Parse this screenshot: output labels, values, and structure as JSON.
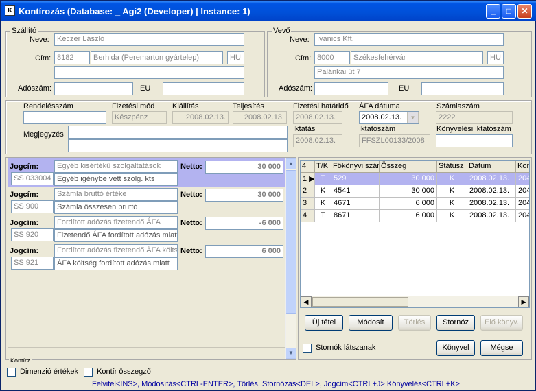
{
  "window": {
    "title": "Kontírozás    (Database: _ Agi2 (Developer) | Instance: 1)",
    "icon": "app-icon",
    "min": "_",
    "max": "□",
    "close": "✕"
  },
  "supplier": {
    "legend": "Szállító",
    "name_label": "Neve:",
    "name": "Keczer László",
    "address_label": "Cím:",
    "zip": "8182",
    "city": "Berhida (Peremarton gyártelep)",
    "country": "HU",
    "street": "",
    "tax_label": "Adószám:",
    "tax": "",
    "eu_label": "EU",
    "eu": ""
  },
  "buyer": {
    "legend": "Vevő",
    "name_label": "Neve:",
    "name": "Ivanics Kft.",
    "address_label": "Cím:",
    "zip": "8000",
    "city": "Székesfehérvár",
    "country": "HU",
    "street": "Palánkai út 7",
    "tax_label": "Adószám:",
    "tax": "",
    "eu_label": "EU",
    "eu": ""
  },
  "invoice": {
    "order_label": "Rendelésszám",
    "order": "",
    "pay_label": "Fizetési mód",
    "pay": "Készpénz",
    "issue_label": "Kiállítás",
    "issue": "2008.02.13.",
    "perf_label": "Teljesítés",
    "perf": "2008.02.13.",
    "due_label": "Fizetési határidő",
    "due": "2008.02.13.",
    "vat_label": "ÁFA dátuma",
    "vat": "2008.02.13.",
    "invno_label": "Számlaszám",
    "invno": "2222",
    "note_label": "Megjegyzés",
    "note": "",
    "filing_label": "Iktatás",
    "filing": "2008.02.13.",
    "filingno_label": "Iktatószám",
    "filingno": "FFSZL00133/2008",
    "acctfiling_label": "Könyvelési iktatószám",
    "acctfiling": ""
  },
  "postings": [
    {
      "jogcim_label": "Jogcím:",
      "code": "SS 033004",
      "line1": "Egyéb kisértékű szolgáltatások",
      "line2": "Egyéb igénybe vett szolg. kts",
      "netto_label": "Netto:",
      "amount": "30 000"
    },
    {
      "jogcim_label": "Jogcím:",
      "code": "SS 900",
      "line1": "Számla bruttó értéke",
      "line2": "Számla összesen bruttó",
      "netto_label": "Netto:",
      "amount": "30 000"
    },
    {
      "jogcim_label": "Jogcím:",
      "code": "SS 920",
      "line1": "Fordított adózás fizetendő ÁFA",
      "line2": "Fizetendő ÁFA fordított adózás miatt",
      "netto_label": "Netto:",
      "amount": "-6 000"
    },
    {
      "jogcim_label": "Jogcím:",
      "code": "SS 921",
      "line1": "Fordított adózás fizetendő ÁFA költs",
      "line2": "ÁFA költség fordított adózás miatt",
      "netto_label": "Netto:",
      "amount": "6 000"
    }
  ],
  "grid": {
    "count": "4",
    "columns": [
      "T/K",
      "Főkönyvi szár",
      "Összeg",
      "Státusz",
      "Dátum",
      "Kon"
    ],
    "rows": [
      {
        "num": "1",
        "tk": "T",
        "acct": "529",
        "amount": "30 000",
        "status": "K",
        "date": "2008.02.13.",
        "kon": "204"
      },
      {
        "num": "2",
        "tk": "K",
        "acct": "4541",
        "amount": "30 000",
        "status": "K",
        "date": "2008.02.13.",
        "kon": "204"
      },
      {
        "num": "3",
        "tk": "K",
        "acct": "4671",
        "amount": "6 000",
        "status": "K",
        "date": "2008.02.13.",
        "kon": "204"
      },
      {
        "num": "4",
        "tk": "T",
        "acct": "8671",
        "amount": "6 000",
        "status": "K",
        "date": "2008.02.13.",
        "kon": "204"
      }
    ]
  },
  "buttons": {
    "new": "Új tétel",
    "modify": "Módosít",
    "delete": "Törlés",
    "reverse": "Stornóz",
    "prev": "Elő könyv.",
    "post": "Könyvel",
    "cancel": "Mégse"
  },
  "show_reversed": "Stornók látszanak",
  "bottom": {
    "tab": "Kontírz",
    "dim": "Dimenzió értékek",
    "summary": "Kontír összegző",
    "hint": "Felvitel<INS>, Módosítás<CTRL-ENTER>, Törlés, Stornózás<DEL>, Jogcím<CTRL+J> Könyvelés<CTRL+K>"
  },
  "colors": {
    "selected": "#b3b3f0",
    "hint": "#0000a0",
    "title": "#0054e3"
  }
}
